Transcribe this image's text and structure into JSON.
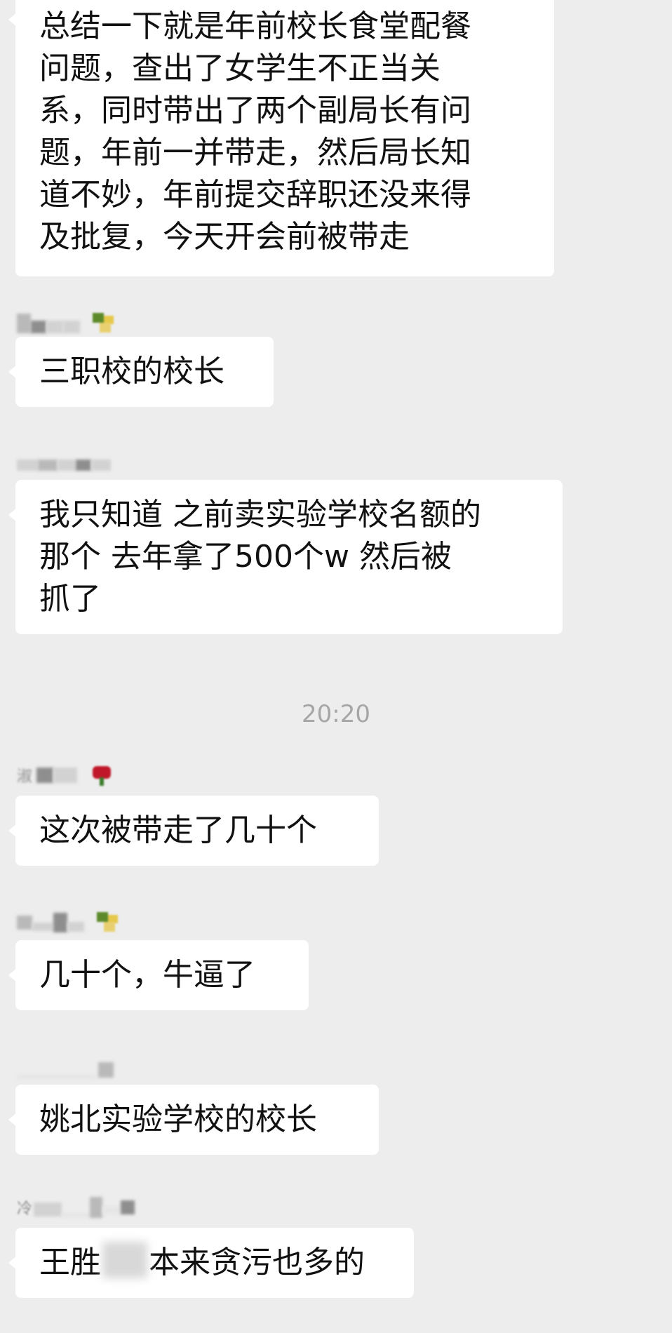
{
  "messages": [
    {
      "id": "m1",
      "lines": [
        "总结一下就是年前校长食堂配餐",
        "问题，查出了女学生不正当关",
        "系，同时带出了两个副局长有问",
        "题，年前一并带走，然后局长知",
        "道不妙，年前提交辞职还没来得",
        "及批复，今天开会前被带走"
      ]
    },
    {
      "id": "m2",
      "lines": [
        "三职校的校长"
      ]
    },
    {
      "id": "m3",
      "lines": [
        "我只知道 之前卖实验学校名额的",
        "那个 去年拿了500个w 然后被",
        "抓了"
      ]
    },
    {
      "id": "m4",
      "lines": [
        "这次被带走了几十个"
      ]
    },
    {
      "id": "m5",
      "lines": [
        "几十个，牛逼了"
      ]
    },
    {
      "id": "m6",
      "lines": [
        "姚北实验学校的校长"
      ]
    },
    {
      "id": "m7",
      "line_prefix": "王胜",
      "line_suffix": "本来贪污也多的"
    }
  ],
  "timestamp": "20:20",
  "sender_names": {
    "s4": "淑",
    "s7": "冷"
  },
  "colors": {
    "background": "#ededed",
    "bubble": "#ffffff",
    "text": "#111111",
    "timestamp": "#a6a6a6"
  }
}
